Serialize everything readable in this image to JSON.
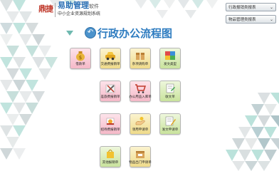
{
  "brand": {
    "logo": "鼎捷",
    "title": "易助管理",
    "title_suffix": "软件",
    "subtitle": "中小企业资源规划系统"
  },
  "quick_links": [
    {
      "label": "行政报销类报表"
    },
    {
      "label": "物品管理类报表"
    }
  ],
  "page": {
    "title": "行政办公流程图"
  },
  "tiles": [
    {
      "label": "借款单",
      "icon": "money-bag-icon",
      "color": "pink"
    },
    {
      "label": "交通费报销单",
      "icon": "car-icon",
      "color": "yellow"
    },
    {
      "label": "杂项请购单",
      "icon": "box-icon",
      "color": "yellow"
    },
    {
      "label": "发文类型",
      "icon": "puzzle-icon",
      "color": "green"
    },
    {
      "label": "差旅费报销单",
      "icon": "tools-icon",
      "color": "pink"
    },
    {
      "label": "办公用品入库单",
      "icon": "cart-icon",
      "color": "pink"
    },
    {
      "label": "收文单",
      "icon": "document-icon",
      "color": "green"
    },
    {
      "label": "招待费报销单",
      "icon": "food-icon",
      "color": "pink"
    },
    {
      "label": "领用申请单",
      "icon": "hand-icon",
      "color": "yellow"
    },
    {
      "label": "发文申请单",
      "icon": "document-pen-icon",
      "color": "green"
    },
    {
      "label": "其他报销单",
      "icon": "gift-bag-icon",
      "color": "green"
    },
    {
      "label": "物品出门申请单",
      "icon": "package-icon",
      "color": "yellow"
    }
  ],
  "colors": {
    "accent": "#2e7cc0",
    "tile_pink": "#f5b9c8",
    "tile_yellow": "#efdb8a",
    "tile_green": "#c9e39c",
    "triangle_teal": "#7fc6bd"
  }
}
